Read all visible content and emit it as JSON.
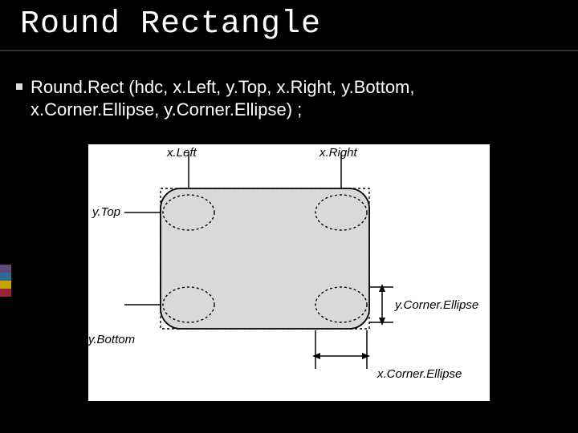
{
  "title": "Round Rectangle",
  "bullet_text": "Round.Rect (hdc, x.Left, y.Top, x.Right, y.Bottom, x.Corner.Ellipse, y.Corner.Ellipse) ;",
  "diagram": {
    "labels": {
      "xLeft": "x.Left",
      "xRight": "x.Right",
      "yTop": "y.Top",
      "yBottom": "y.Bottom",
      "yCornerEllipse": "y.Corner.Ellipse",
      "xCornerEllipse": "x.Corner.Ellipse"
    }
  }
}
